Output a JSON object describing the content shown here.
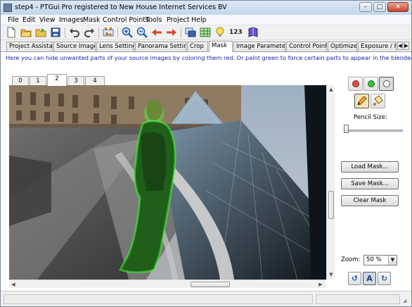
{
  "window": {
    "title": "step4 - PTGui Pro registered to New House Internet Services BV"
  },
  "menu": [
    "File",
    "Edit",
    "View",
    "Images",
    "Mask",
    "Control Points",
    "Tools",
    "Project",
    "Help"
  ],
  "toolbar": {
    "number_label": "123"
  },
  "tabs": [
    {
      "label": "Project Assistant",
      "active": false
    },
    {
      "label": "Source Images",
      "active": false
    },
    {
      "label": "Lens Settings",
      "active": false
    },
    {
      "label": "Panorama Settings",
      "active": false
    },
    {
      "label": "Crop",
      "active": false
    },
    {
      "label": "Mask",
      "active": true
    },
    {
      "label": "Image Parameters",
      "active": false
    },
    {
      "label": "Control Points",
      "active": false
    },
    {
      "label": "Optimizer",
      "active": false
    },
    {
      "label": "Exposure / H",
      "active": false
    }
  ],
  "mask_panel": {
    "info": "Here you can hide unwanted parts of your source images by coloring them red. Or paint green to force certain parts to appear in the blended panorama.",
    "image_tabs": [
      "0",
      "1",
      "2",
      "3",
      "4"
    ],
    "active_image": "2",
    "pencil_size_label": "Pencil Size:",
    "pencil_size_value": 0.0,
    "buttons": {
      "load": "Load Mask...",
      "save": "Save Mask...",
      "clear": "Clear Mask"
    },
    "zoom_label": "Zoom:",
    "zoom_value": "50 %",
    "auto_button": "A"
  },
  "colors": {
    "info_text": "#1a1aa8",
    "mask_green": "#2e9a26",
    "red_dot": "#e04b4b",
    "green_dot": "#3cc23c"
  }
}
